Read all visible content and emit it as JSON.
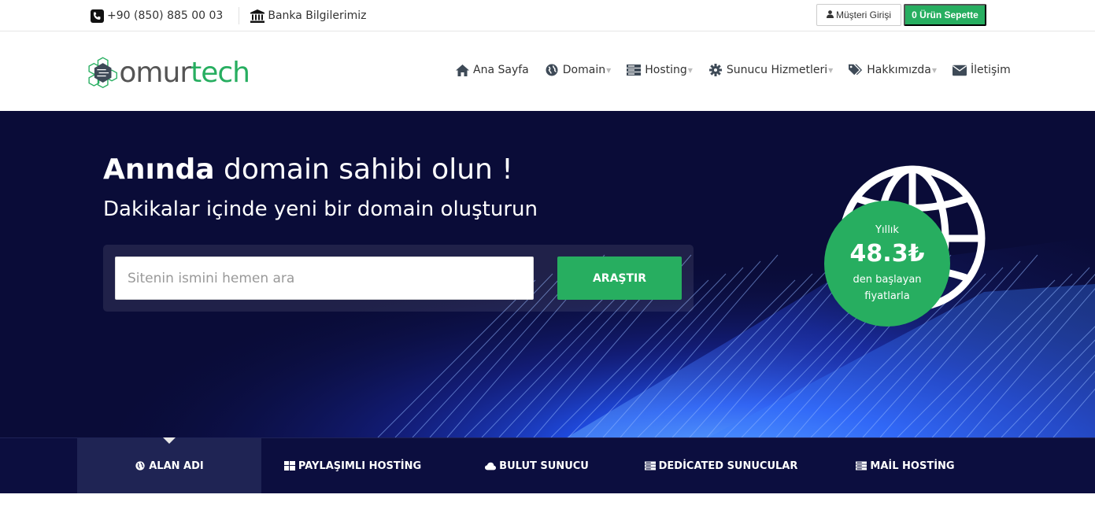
{
  "topbar": {
    "phone": "+90 (850) 885 00 03",
    "bank_info": "Banka Bilgilerimiz",
    "login_label": "Müşteri Girişi",
    "cart_label": "0 Ürün Sepette"
  },
  "brand": {
    "name_part1": "omur",
    "name_part2": "tech",
    "accent_color": "#27ae60"
  },
  "nav": {
    "items": [
      {
        "label": "Ana Sayfa",
        "icon": "home-icon",
        "dropdown": false
      },
      {
        "label": "Domain",
        "icon": "globe-icon",
        "dropdown": true
      },
      {
        "label": "Hosting",
        "icon": "server-icon",
        "dropdown": true
      },
      {
        "label": "Sunucu Hizmetleri",
        "icon": "gear-icon",
        "dropdown": true
      },
      {
        "label": "Hakkımızda",
        "icon": "tags-icon",
        "dropdown": true
      },
      {
        "label": "İletişim",
        "icon": "envelope-icon",
        "dropdown": false
      }
    ]
  },
  "hero": {
    "title_bold": "Anında",
    "title_rest": " domain sahibi olun !",
    "subtitle": "Dakikalar içinde yeni bir domain oluşturun",
    "search_placeholder": "Sitenin ismini hemen ara",
    "search_button": "ARAŞTIR",
    "badge_line1": "Yıllık",
    "badge_price": "48.3₺",
    "badge_line3": "den başlayan",
    "badge_line4": "fiyatlarla"
  },
  "tabs": [
    {
      "label": "ALAN ADI",
      "icon": "globe-icon",
      "active": true
    },
    {
      "label": "PAYLAŞIMLI HOSTİNG",
      "icon": "grid-icon",
      "active": false
    },
    {
      "label": "BULUT SUNUCU",
      "icon": "cloud-icon",
      "active": false
    },
    {
      "label": "DEDİCATED SUNUCULAR",
      "icon": "server-icon",
      "active": false
    },
    {
      "label": "MAİL HOSTİNG",
      "icon": "server-icon",
      "active": false
    }
  ]
}
